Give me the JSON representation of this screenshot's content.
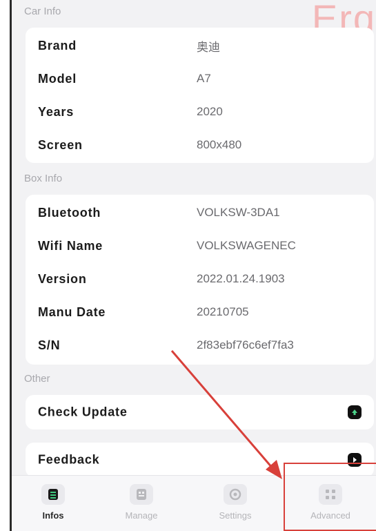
{
  "watermark": "Erq",
  "car_info": {
    "title": "Car Info",
    "rows": [
      {
        "label": "Brand",
        "value": "奥迪"
      },
      {
        "label": "Model",
        "value": "A7"
      },
      {
        "label": "Years",
        "value": "2020"
      },
      {
        "label": "Screen",
        "value": "800x480"
      }
    ]
  },
  "box_info": {
    "title": "Box Info",
    "rows": [
      {
        "label": "Bluetooth",
        "value": "VOLKSW-3DA1"
      },
      {
        "label": "Wifi Name",
        "value": "VOLKSWAGENEC"
      },
      {
        "label": "Version",
        "value": "2022.01.24.1903"
      },
      {
        "label": "Manu Date",
        "value": "20210705"
      },
      {
        "label": "S/N",
        "value": "2f83ebf76c6ef7fa3"
      }
    ]
  },
  "other": {
    "title": "Other",
    "check_update": {
      "label": "Check Update",
      "icon": "arrow-up-icon"
    },
    "feedback": {
      "label": "Feedback",
      "icon": "chevron-right-icon"
    }
  },
  "tabbar": {
    "tabs": [
      {
        "label": "Infos",
        "icon": "infos-icon",
        "active": true
      },
      {
        "label": "Manage",
        "icon": "manage-icon",
        "active": false
      },
      {
        "label": "Settings",
        "icon": "settings-icon",
        "active": false
      },
      {
        "label": "Advanced",
        "icon": "grid-icon",
        "active": false
      }
    ]
  },
  "colors": {
    "highlight": "#d8403a",
    "accent_green": "#1f8a4c"
  }
}
